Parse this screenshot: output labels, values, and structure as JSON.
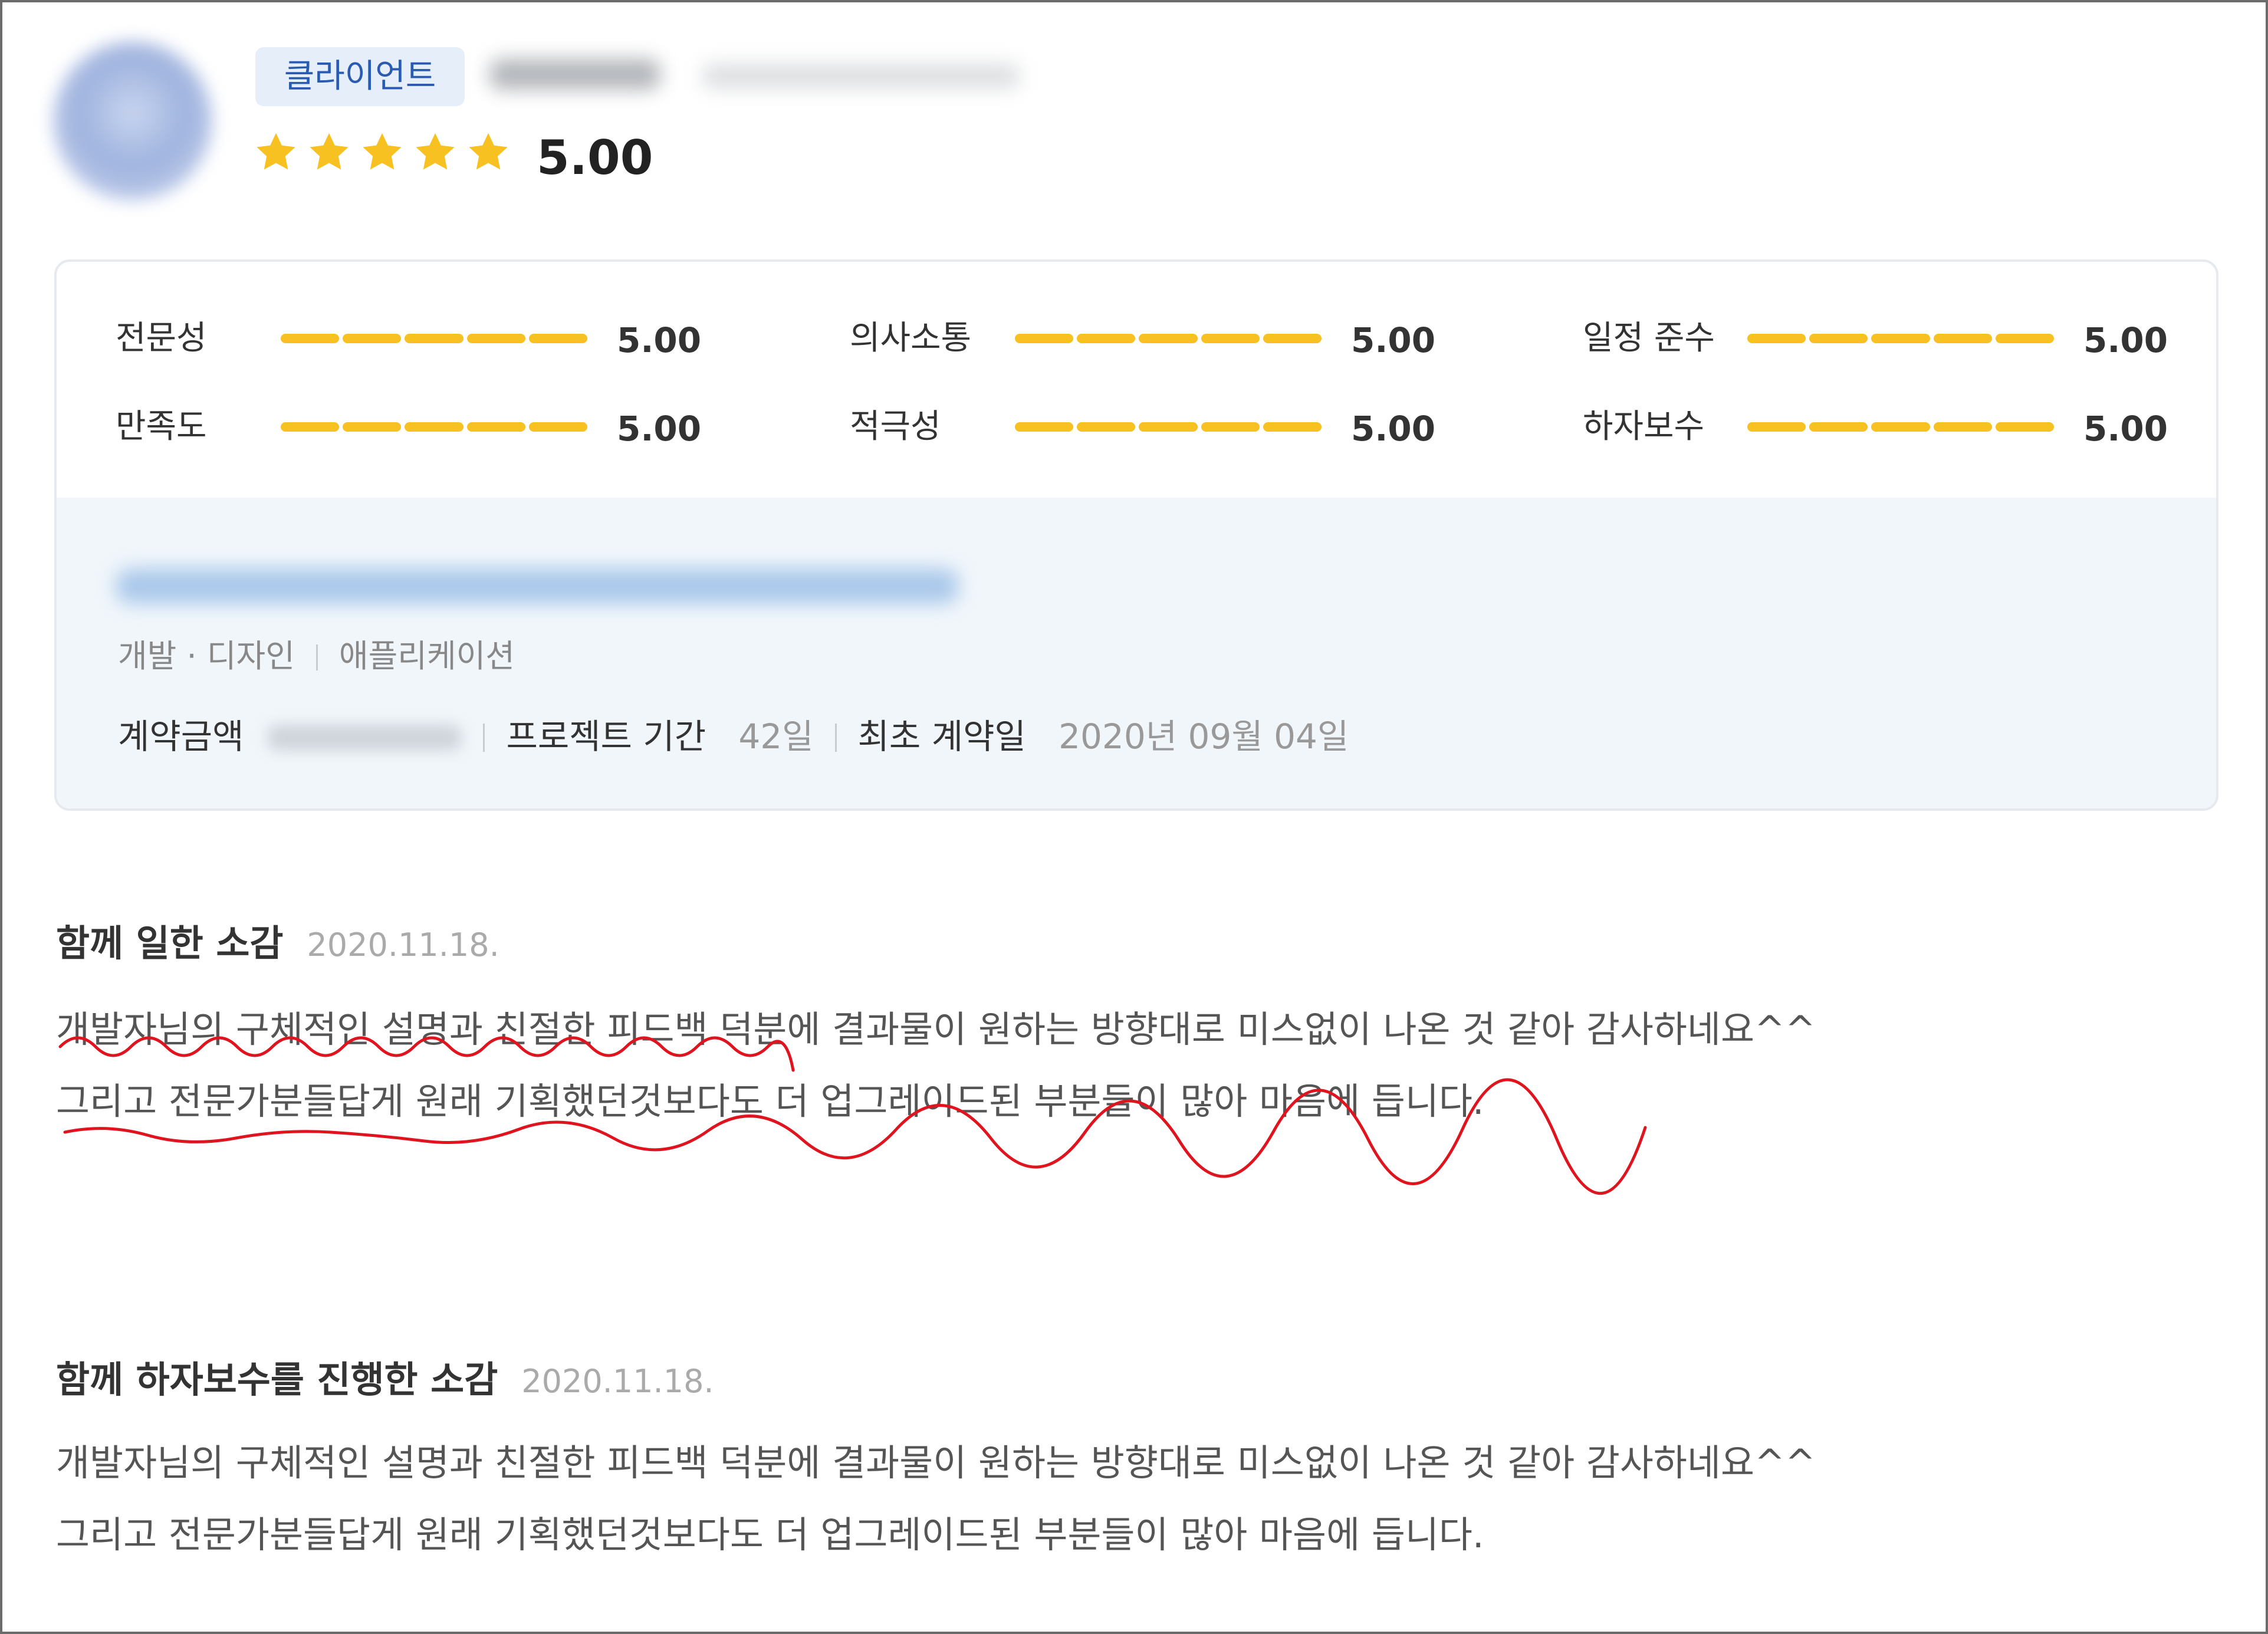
{
  "header": {
    "badge": "클라이언트",
    "rating": "5.00"
  },
  "scores": [
    {
      "label": "전문성",
      "value": "5.00"
    },
    {
      "label": "의사소통",
      "value": "5.00"
    },
    {
      "label": "일정 준수",
      "value": "5.00"
    },
    {
      "label": "만족도",
      "value": "5.00"
    },
    {
      "label": "적극성",
      "value": "5.00"
    },
    {
      "label": "하자보수",
      "value": "5.00"
    }
  ],
  "project": {
    "category_main": "개발 · 디자인",
    "category_sub": "애플리케이션",
    "contract_label": "계약금액",
    "period_label": "프로젝트 기간",
    "period_value": "42일",
    "first_contract_label": "최초 계약일",
    "first_contract_value": "2020년 09월 04일"
  },
  "reviews": [
    {
      "title": "함께 일한 소감",
      "date": "2020.11.18.",
      "line1": "개발자님의 구체적인 설명과 친절한 피드백 덕분에 결과물이 원하는 방향대로 미스없이 나온 것 같아 감사하네요^^",
      "line2": "그리고 전문가분들답게 원래 기획했던것보다도 더 업그레이드된 부분들이 많아 마음에 듭니다."
    },
    {
      "title": "함께 하자보수를 진행한 소감",
      "date": "2020.11.18.",
      "line1": "개발자님의 구체적인 설명과 친절한 피드백 덕분에 결과물이 원하는 방향대로 미스없이 나온 것 같아 감사하네요^^",
      "line2": "그리고 전문가분들답게 원래 기획했던것보다도 더 업그레이드된 부분들이 많아 마음에 듭니다."
    }
  ],
  "colors": {
    "star": "#F7C122",
    "bar": "#F7C122",
    "annotation": "#E0141E",
    "badge_bg": "#E6EEFA",
    "badge_text": "#2A5BB0"
  }
}
